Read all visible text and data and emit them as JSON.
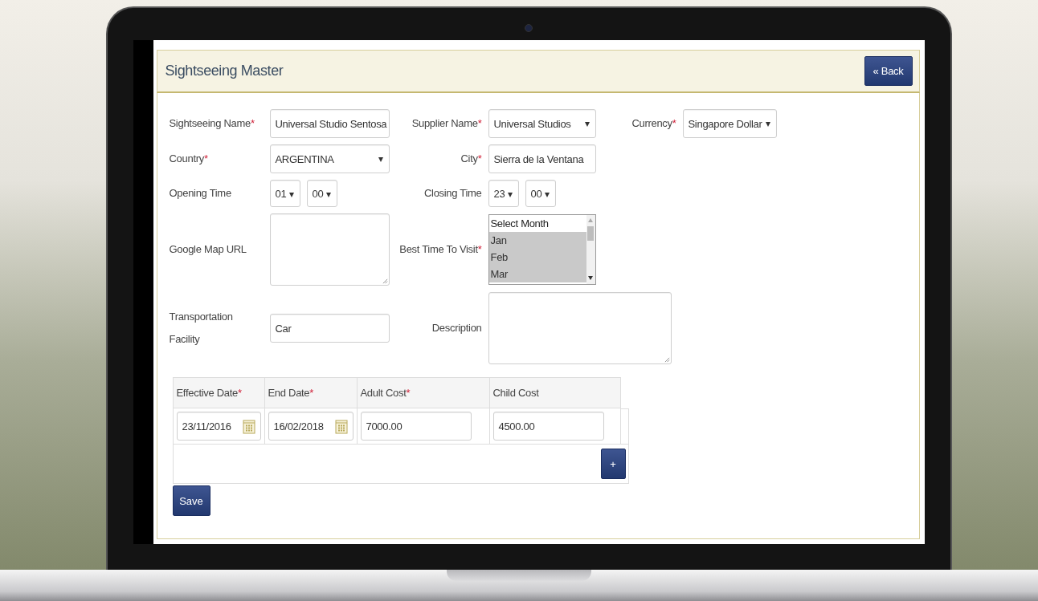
{
  "required_mark": "*",
  "panel": {
    "title": "Sightseeing Master",
    "back_button": "« Back"
  },
  "form_rows": [
    [
      {
        "label": "Sightseeing Name",
        "required": true,
        "kind": "text",
        "value": "Universal Studio Sentosa"
      },
      {
        "label": "Supplier Name",
        "required": true,
        "kind": "select",
        "value": "Universal Studios"
      },
      {
        "label": "Currency",
        "required": true,
        "kind": "select",
        "value": "Singapore Dollar"
      }
    ],
    [
      {
        "label": "Country",
        "required": true,
        "kind": "select",
        "value": "ARGENTINA"
      },
      {
        "label": "City",
        "required": true,
        "kind": "text",
        "value": "Sierra de la Ventana"
      }
    ],
    [
      {
        "label": "Opening Time",
        "required": false,
        "kind": "time",
        "hour": "01",
        "minute": "00"
      },
      {
        "label": "Closing Time",
        "required": false,
        "kind": "time",
        "hour": "23",
        "minute": "00"
      }
    ],
    [
      {
        "label": "Google Map URL",
        "required": false,
        "kind": "textarea"
      },
      {
        "label": "Best Time To Visit",
        "required": true,
        "kind": "listbox",
        "options": [
          {
            "label": "Select Month",
            "selected": false
          },
          {
            "label": "Jan",
            "selected": true
          },
          {
            "label": "Feb",
            "selected": true
          },
          {
            "label": "Mar",
            "selected": true
          }
        ]
      }
    ],
    [
      {
        "label": "Transportation Facility",
        "required": false,
        "kind": "text",
        "value": "Car"
      },
      {
        "label": "Description",
        "required": false,
        "kind": "textarea"
      }
    ]
  ],
  "cost_table": {
    "columns": [
      {
        "label": "Effective Date",
        "required": true
      },
      {
        "label": "End Date",
        "required": true
      },
      {
        "label": "Adult Cost",
        "required": true
      },
      {
        "label": "Child Cost",
        "required": false
      }
    ],
    "rows": [
      [
        {
          "kind": "date",
          "value": "23/11/2016"
        },
        {
          "kind": "date",
          "value": "16/02/2018"
        },
        {
          "kind": "text",
          "value": "7000.00"
        },
        {
          "kind": "text",
          "value": "4500.00"
        }
      ]
    ],
    "add_button": "+"
  },
  "save_button": "Save"
}
